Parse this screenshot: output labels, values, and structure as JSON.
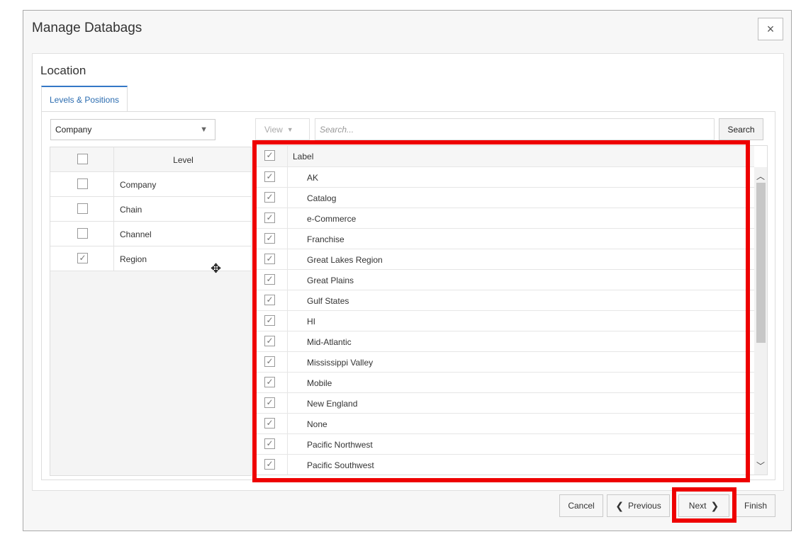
{
  "dialog": {
    "title": "Manage Databags",
    "close_label": "×"
  },
  "section": {
    "title": "Location",
    "tab_label": "Levels & Positions"
  },
  "level_select": {
    "value": "Company"
  },
  "level_table": {
    "header": "Level",
    "rows": [
      {
        "label": "Company",
        "checked": false
      },
      {
        "label": "Chain",
        "checked": false
      },
      {
        "label": "Channel",
        "checked": false
      },
      {
        "label": "Region",
        "checked": true
      }
    ]
  },
  "toolbar": {
    "view_label": "View",
    "search_placeholder": "Search...",
    "search_button": "Search"
  },
  "position_grid": {
    "header": "Label",
    "rows": [
      {
        "label": "AK",
        "checked": true
      },
      {
        "label": "Catalog",
        "checked": true
      },
      {
        "label": "e-Commerce",
        "checked": true
      },
      {
        "label": "Franchise",
        "checked": true
      },
      {
        "label": "Great Lakes Region",
        "checked": true
      },
      {
        "label": "Great Plains",
        "checked": true
      },
      {
        "label": "Gulf States",
        "checked": true
      },
      {
        "label": "HI",
        "checked": true
      },
      {
        "label": "Mid-Atlantic",
        "checked": true
      },
      {
        "label": "Mississippi Valley",
        "checked": true
      },
      {
        "label": "Mobile",
        "checked": true
      },
      {
        "label": "New England",
        "checked": true
      },
      {
        "label": "None",
        "checked": true
      },
      {
        "label": "Pacific Northwest",
        "checked": true
      },
      {
        "label": "Pacific Southwest",
        "checked": true
      }
    ]
  },
  "footer": {
    "cancel": "Cancel",
    "previous": "Previous",
    "next": "Next",
    "finish": "Finish"
  },
  "highlight_color": "#ee0000"
}
